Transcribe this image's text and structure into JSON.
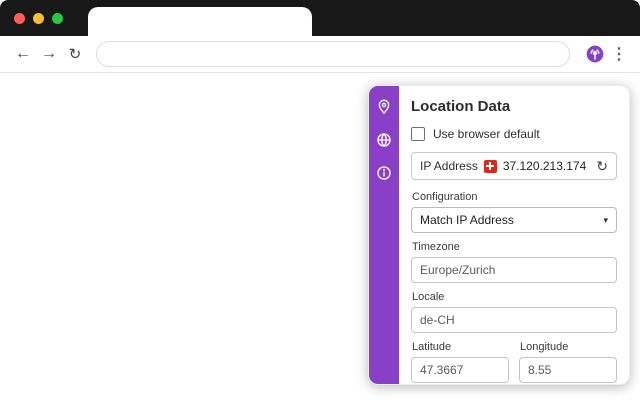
{
  "browser": {
    "tab_title": "",
    "address_value": "",
    "icons": {
      "back": "←",
      "forward": "→",
      "reload": "↻",
      "menu": "⋮"
    }
  },
  "popup": {
    "title": "Location Data",
    "checkbox_label": "Use browser default",
    "ip_row": {
      "label": "IP Address",
      "value": "37.120.213.174",
      "flag_country": "CH",
      "refresh_icon": "↻"
    },
    "configuration": {
      "label": "Configuration",
      "value": "Match IP Address",
      "caret_icon": "▾"
    },
    "timezone": {
      "label": "Timezone",
      "value": "Europe/Zurich"
    },
    "locale": {
      "label": "Locale",
      "value": "de-CH"
    },
    "latitude": {
      "label": "Latitude",
      "value": "47.3667"
    },
    "longitude": {
      "label": "Longitude",
      "value": "8.55"
    }
  },
  "colors": {
    "accent": "#8a3fc7",
    "flag_red": "#d52b1e",
    "traffic_red": "#ff5f57",
    "traffic_yellow": "#febc2e",
    "traffic_green": "#28c840"
  }
}
